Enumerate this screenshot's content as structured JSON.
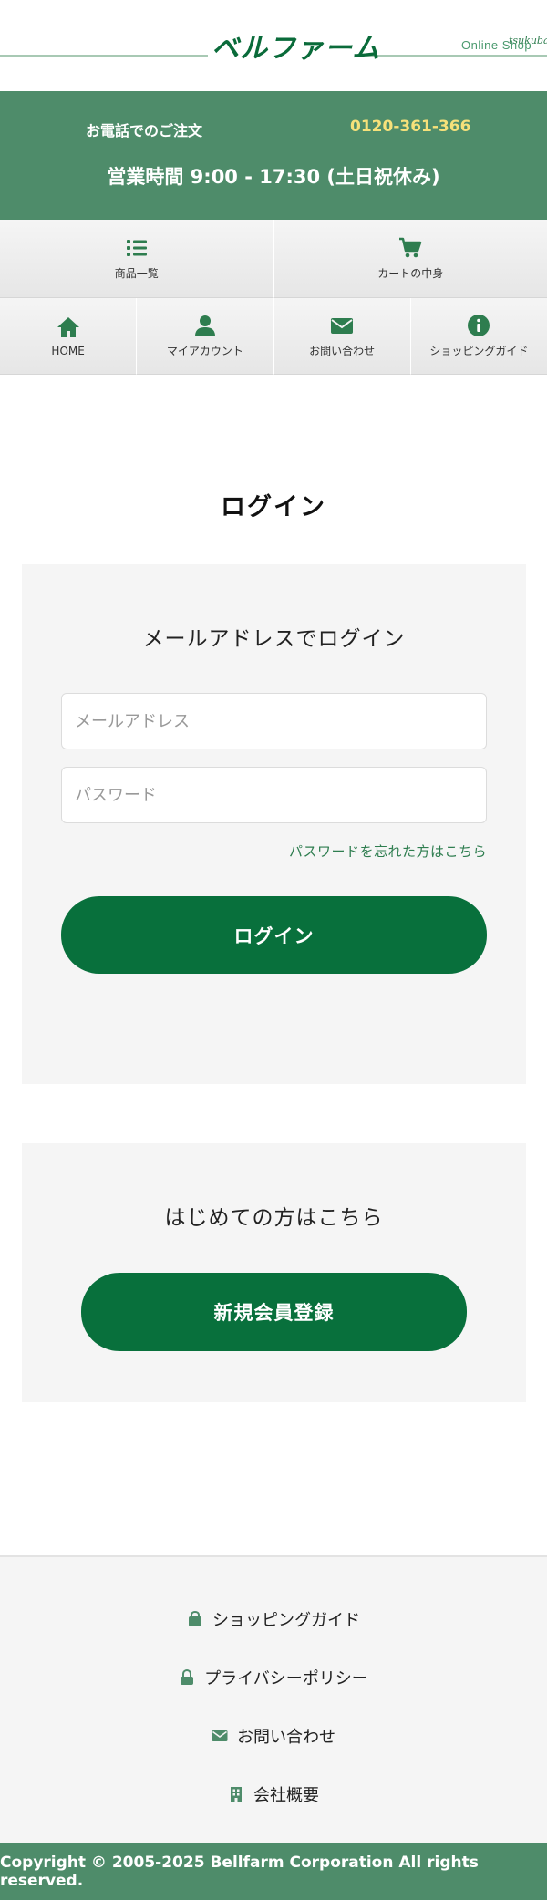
{
  "header": {
    "logo_text": "ベルファーム",
    "logo_sub": "tsukuba",
    "online_shop": "Online Shop"
  },
  "phone": {
    "label": "お電話でのご注文",
    "number": "0120-361-366",
    "hours": "営業時間 9:00 - 17:30 (土日祝休み)"
  },
  "nav_primary": [
    {
      "label": "商品一覧",
      "icon": "list-icon"
    },
    {
      "label": "カートの中身",
      "icon": "cart-icon"
    }
  ],
  "nav_secondary": [
    {
      "label": "HOME",
      "icon": "home-icon"
    },
    {
      "label": "マイアカウント",
      "icon": "user-icon"
    },
    {
      "label": "お問い合わせ",
      "icon": "mail-icon"
    },
    {
      "label": "ショッピングガイド",
      "icon": "info-icon"
    }
  ],
  "page_title": "ログイン",
  "login": {
    "heading": "メールアドレスでログイン",
    "email_placeholder": "メールアドレス",
    "password_placeholder": "パスワード",
    "forgot_link": "パスワードを忘れた方はこちら",
    "button": "ログイン"
  },
  "signup": {
    "heading": "はじめての方はこちら",
    "button": "新規会員登録"
  },
  "footer": {
    "links": [
      {
        "label": "ショッピングガイド",
        "icon": "bag-icon"
      },
      {
        "label": "プライバシーポリシー",
        "icon": "lock-icon"
      },
      {
        "label": "お問い合わせ",
        "icon": "mail-icon"
      },
      {
        "label": "会社概要",
        "icon": "building-icon"
      }
    ],
    "copyright": "Copyright © 2005-2025 Bellfarm Corporation All rights reserved."
  },
  "colors": {
    "brand_green": "#08703c",
    "band_green": "#4e8c6a",
    "phone_yellow": "#f6e17a"
  }
}
